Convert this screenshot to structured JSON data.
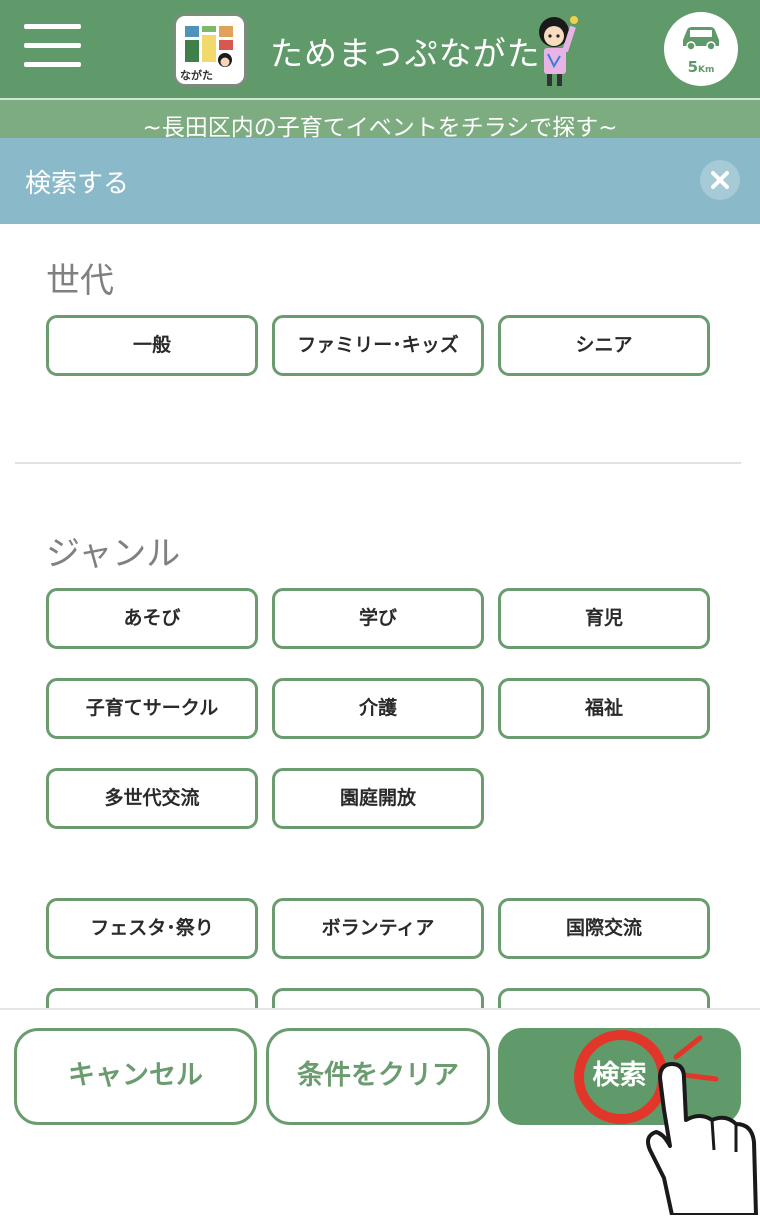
{
  "header": {
    "app_title": "ためまっぷながた",
    "logo_text": "ながた",
    "distance_value": "5",
    "distance_unit": "Km",
    "subtitle": "~長田区内の子育てイベントをチラシで探す~"
  },
  "search_panel": {
    "title": "検索する",
    "close_icon": "close-icon"
  },
  "sections": {
    "generation": {
      "title": "世代",
      "options": [
        "一般",
        "ファミリー･キッズ",
        "シニア"
      ]
    },
    "genre": {
      "title": "ジャンル",
      "options": [
        "あそび",
        "学び",
        "育児",
        "子育てサークル",
        "介護",
        "福祉",
        "多世代交流",
        "園庭開放"
      ],
      "options2": [
        "フェスタ･祭り",
        "ボランティア",
        "国際交流"
      ]
    }
  },
  "footer": {
    "cancel_label": "キャンセル",
    "clear_label": "条件をクリア",
    "search_label": "検索"
  },
  "colors": {
    "primary_green": "#609a6a",
    "panel_blue": "#8ab9c9",
    "highlight_red": "#e3362a"
  },
  "icons": [
    "menu-icon",
    "car-icon",
    "close-icon",
    "pointing-hand-icon"
  ]
}
